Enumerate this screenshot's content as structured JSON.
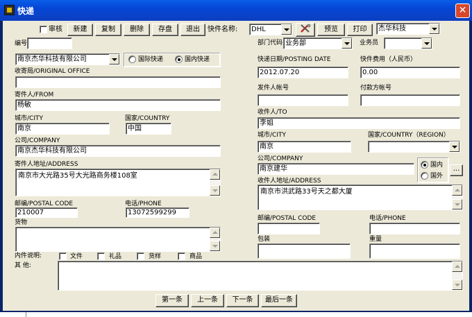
{
  "window": {
    "title": "快递",
    "close_glyph": "✕"
  },
  "toolbar": {
    "audit_label": "审核",
    "new_label": "新建",
    "copy_label": "复制",
    "delete_label": "删除",
    "save_label": "存盘",
    "exit_label": "退出",
    "express_name_label": "快件名称:",
    "express_name_value": "DHL",
    "tool_icon": "tools-icon",
    "preview_label": "预览",
    "print_label": "打印",
    "company_select": "杰华科技"
  },
  "form": {
    "serial_label": "编号",
    "serial_value": "",
    "sender_company_select": "南京杰华科技有限公司",
    "intl_label": "国际快递",
    "domestic_label": "国内快递",
    "origin_office_label": "收寄局/ORIGINAL OFFICE",
    "origin_office_value": "",
    "sender_label": "寄件人/FROM",
    "sender_value": "杨敏",
    "sender_city_label": "城市/CITY",
    "sender_city_value": "南京",
    "sender_country_label": "国家/COUNTRY",
    "sender_country_value": "中国",
    "sender_company_label": "公司/COMPANY",
    "sender_company_value": "南京杰华科技有限公司",
    "sender_address_label": "寄件人地址/ADDRESS",
    "sender_address_value": "南京市大光路35号大光路商务楼108室",
    "sender_postal_label": "邮编/POSTAL CODE",
    "sender_postal_value": "210007",
    "sender_phone_label": "电话/PHONE",
    "sender_phone_value": "13072599299",
    "goods_label": "货物",
    "goods_value": "",
    "dept_label": "部门代码",
    "dept_value": "业务部",
    "staff_label": "业务员",
    "staff_value": "",
    "date_label": "快递日期/POSTING DATE",
    "date_value": "2012.07.20",
    "fee_label": "快件费用（人民币）",
    "fee_value": "0.00",
    "sender_account_label": "发件人帐号",
    "sender_account_value": "",
    "payer_account_label": "付款方帐号",
    "payer_account_value": "",
    "recipient_label": "收件人/TO",
    "recipient_value": "李姐",
    "recipient_city_label": "城市/CITY",
    "recipient_city_value": "南京",
    "recipient_country_label": "国家/COUNTRY（REGION）",
    "recipient_country_value": "",
    "recipient_company_label": "公司/COMPANY",
    "recipient_company_value": "南京建华",
    "domestic_radio_label": "国内",
    "foreign_radio_label": "国外",
    "more_label": "...",
    "recipient_address_label": "收件人地址/ADDRESS",
    "recipient_address_value": "南京市洪武路33号天之都大厦",
    "recipient_postal_label": "邮编/POSTAL CODE",
    "recipient_postal_value": "",
    "recipient_phone_label": "电话/PHONE",
    "recipient_phone_value": "",
    "packing_label": "包装",
    "packing_value": "",
    "weight_label": "重量",
    "weight_value": "",
    "contents_label": "内件说明:",
    "doc_label": "文件",
    "gift_label": "礼品",
    "sample_label": "货样",
    "goods_chk_label": "商品",
    "other_label": "其    他:",
    "other_value": ""
  },
  "nav": {
    "first_label": "第一条",
    "prev_label": "上一条",
    "next_label": "下一条",
    "last_label": "最后一条"
  }
}
